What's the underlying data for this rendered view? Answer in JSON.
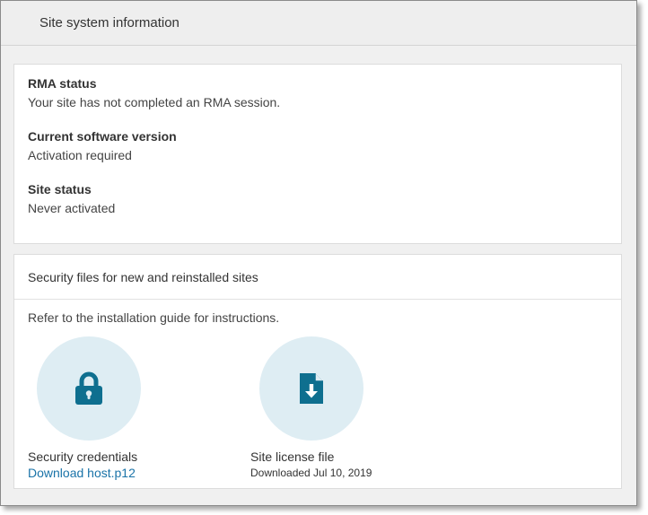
{
  "header": {
    "title": "Site system information"
  },
  "info": {
    "items": [
      {
        "label": "RMA status",
        "value": "Your site has not completed an RMA session."
      },
      {
        "label": "Current software version",
        "value": "Activation required"
      },
      {
        "label": "Site status",
        "value": "Never activated"
      }
    ]
  },
  "security": {
    "title": "Security files for new and reinstalled sites",
    "note": "Refer to the installation guide for instructions.",
    "credentials": {
      "icon": "lock-icon",
      "title": "Security credentials",
      "link": "Download host.p12"
    },
    "license": {
      "icon": "file-download-icon",
      "title": "Site license file",
      "subtitle": "Downloaded Jul 10, 2019"
    }
  },
  "colors": {
    "accent": "#0e6f8f",
    "icon_circle": "#deedf3",
    "link": "#1a73a8"
  }
}
